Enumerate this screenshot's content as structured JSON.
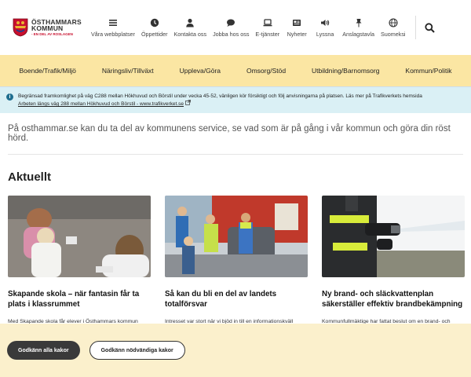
{
  "header": {
    "logo": {
      "line1": "ÖSTHAMMARS",
      "line2": "KOMMUN",
      "tagline": "- EN DEL AV ROSLAGEN"
    },
    "top_links": [
      {
        "label": "Våra webbplatser",
        "icon": "menu-icon"
      },
      {
        "label": "Öppettider",
        "icon": "clock-icon"
      },
      {
        "label": "Kontakta oss",
        "icon": "person-icon"
      },
      {
        "label": "Jobba hos oss",
        "icon": "chat-icon"
      },
      {
        "label": "E-tjänster",
        "icon": "laptop-icon"
      },
      {
        "label": "Nyheter",
        "icon": "newspaper-icon"
      },
      {
        "label": "Lyssna",
        "icon": "speaker-icon"
      },
      {
        "label": "Anslagstavla",
        "icon": "pin-icon"
      },
      {
        "label": "Suomeksi",
        "icon": "globe-icon"
      }
    ]
  },
  "main_nav": [
    "Boende/Trafik/Miljö",
    "Näringsliv/Tillväxt",
    "Uppleva/Göra",
    "Omsorg/Stöd",
    "Utbildning/Barnomsorg",
    "Kommun/Politik"
  ],
  "alert": {
    "text": "Begränsad framkomlighet på väg C288 mellan Hökhuvud och Börstil under vecka 45-52, vänligen kör försiktigt och följ anvisningarna på platsen. Läs mer på Trafikverkets hemsida",
    "link": "Arbeten längs väg 288 mellan Hökhuvud och Börstil - www.trafikverket.se"
  },
  "intro": "På osthammar.se kan du ta del av kommunens service, se vad som är på gång i vår kommun och göra din röst hörd.",
  "news": {
    "heading": "Aktuellt",
    "items": [
      {
        "title": "Skapande skola – när fantasin får ta plats i klassrummet",
        "excerpt": "Med Skapande skola får elever i Östhammars kommun"
      },
      {
        "title": "Så kan du bli en del av landets totalförsvar",
        "excerpt": "Intresset var stort när vi bjöd in till en informationskväll"
      },
      {
        "title": "Ny brand- och släckvattenplan säkerställer effektiv brandbekämpning",
        "excerpt": "Kommunfullmäktige har fattat beslut om en brand- och"
      }
    ]
  },
  "cookie": {
    "accept_all": "Godkänn alla kakor",
    "accept_necessary": "Godkänn nödvändiga kakor"
  },
  "colors": {
    "nav_bg": "#fbe6a3",
    "alert_bg": "#daf0f5",
    "cookie_bg": "#fbf0cc"
  }
}
